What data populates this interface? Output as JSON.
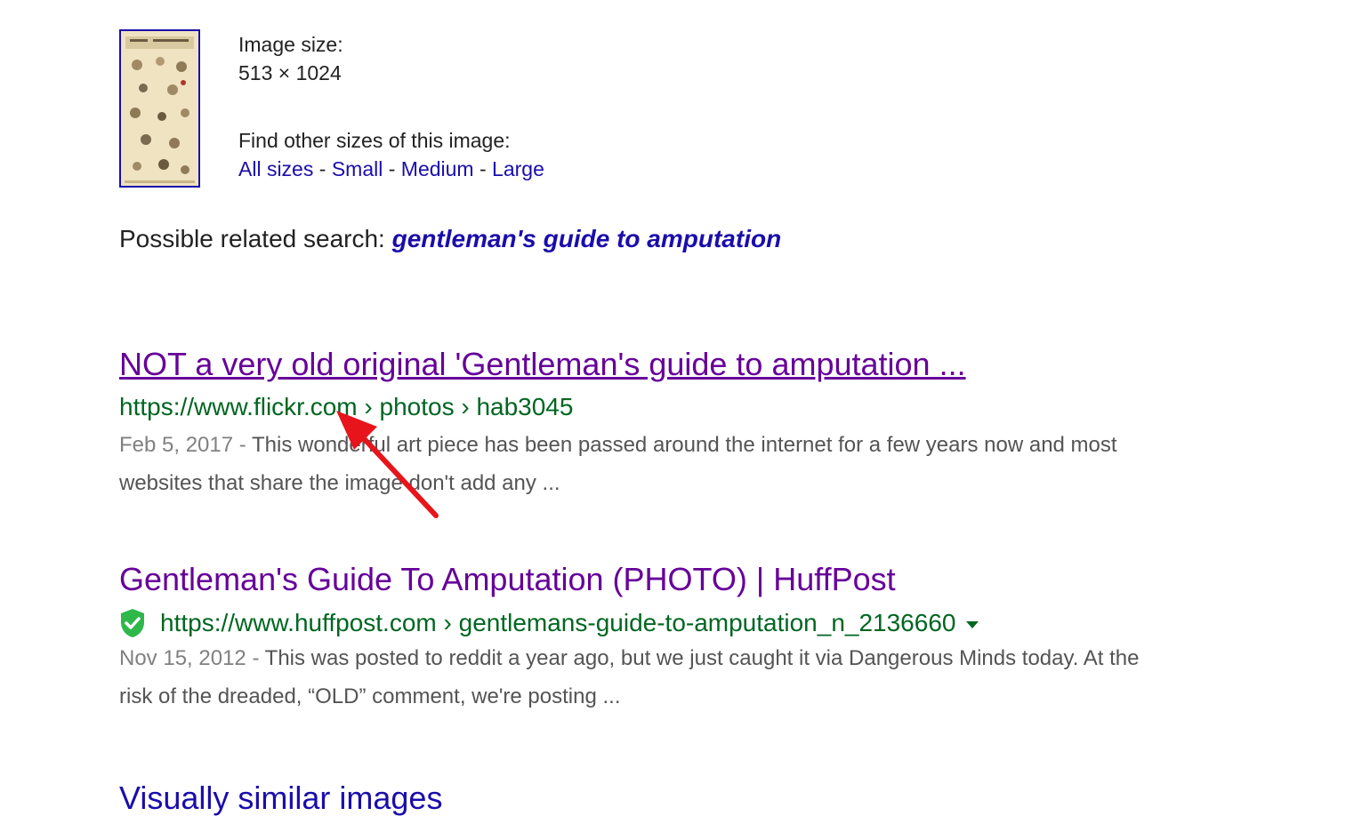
{
  "image_info": {
    "size_label": "Image size:",
    "size_value": "513 × 1024",
    "find_label": "Find other sizes of this image:",
    "sizes": [
      "All sizes",
      "Small",
      "Medium",
      "Large"
    ],
    "separator": " - "
  },
  "related": {
    "label": "Possible related search: ",
    "query": "gentleman's guide to amputation"
  },
  "results": [
    {
      "title": "NOT a very old original 'Gentleman's guide to amputation ...",
      "url": "https://www.flickr.com › photos › hab3045",
      "date": "Feb 5, 2017 - ",
      "snippet": "This wonderful art piece has been passed around the internet for a few years now and most websites that share the image don't add any ..."
    },
    {
      "title": "Gentleman's Guide To Amputation (PHOTO) | HuffPost",
      "url": "https://www.huffpost.com › gentlemans-guide-to-amputation_n_2136660",
      "date": "Nov 15, 2012 - ",
      "snippet": "This was posted to reddit a year ago, but we just caught it via Dangerous Minds today. At the risk of the dreaded, “OLD” comment, we're posting ..."
    }
  ],
  "similar_heading": "Visually similar images",
  "colors": {
    "link": "#1a0dab",
    "visited": "#660099",
    "url_green": "#006621",
    "snippet": "#545454",
    "annotation_arrow": "#e8141c"
  },
  "icons": [
    "verified-shield-icon",
    "dropdown-caret-icon",
    "annotation-arrow"
  ]
}
